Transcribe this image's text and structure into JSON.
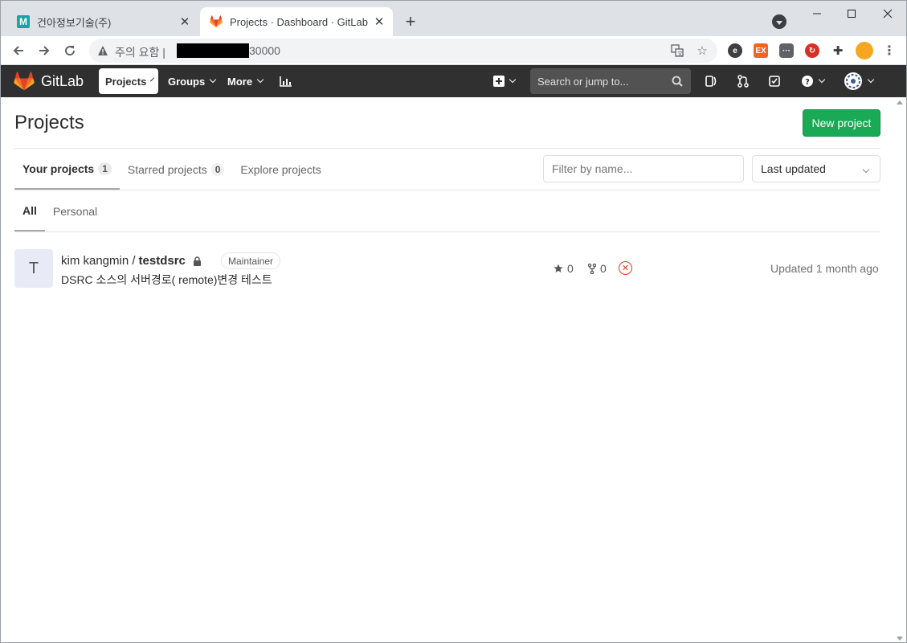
{
  "browser": {
    "tabs": [
      {
        "title": "건아정보기술(주)",
        "favicon": "m-logo-icon"
      },
      {
        "title": "Projects · Dashboard · GitLab",
        "favicon": "gitlab-tanuki-icon"
      }
    ],
    "close_glyph": "✕",
    "new_tab_glyph": "+",
    "security_warning": "주의 요함",
    "url_suffix": "30000",
    "window_controls": {
      "minimize": "—",
      "maximize": "☐",
      "close": "✕"
    }
  },
  "gitlab_nav": {
    "brand": "GitLab",
    "links": {
      "projects": "Projects",
      "groups": "Groups",
      "more": "More"
    },
    "search_placeholder": "Search or jump to...",
    "colors": {
      "navbar": "#303030",
      "search": "#525252"
    }
  },
  "page": {
    "title": "Projects",
    "new_project_label": "New project",
    "scope_tabs": [
      {
        "label": "Your projects",
        "count": "1"
      },
      {
        "label": "Starred projects",
        "count": "0"
      },
      {
        "label": "Explore projects"
      }
    ],
    "filter_placeholder": "Filter by name...",
    "sort_value": "Last updated",
    "visibility_tabs": [
      {
        "label": "All"
      },
      {
        "label": "Personal"
      }
    ],
    "accent_green": "#1aaa55"
  },
  "projects": [
    {
      "avatar_letter": "T",
      "namespace": "kim kangmin /",
      "name": "testdsrc",
      "role": "Maintainer",
      "description": "DSRC 소스의 서버경로( remote)변경 테스트",
      "stars": "0",
      "forks": "0",
      "pipeline_status": "failed",
      "updated": "Updated 1 month ago"
    }
  ]
}
